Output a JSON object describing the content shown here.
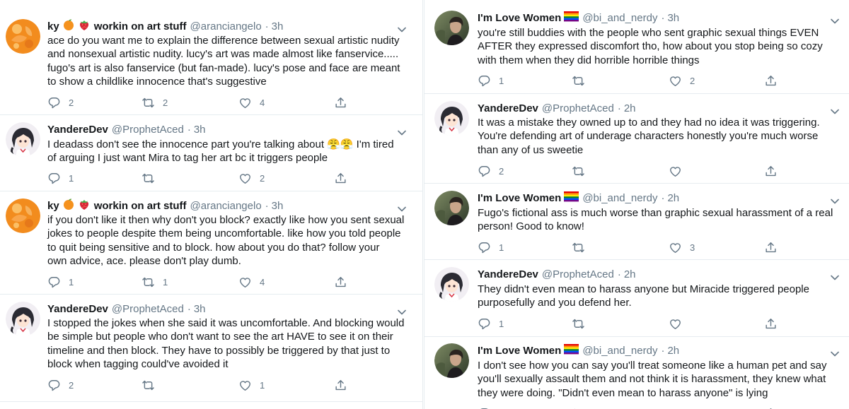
{
  "left_column": {
    "tweets": [
      {
        "name": "ky",
        "name_suffix": "workin on art stuff",
        "emoji_names": [
          "orange-emoji",
          "strawberry-emoji"
        ],
        "handle": "@aranciangelo",
        "time": "3h",
        "avatar": "orange-avatar",
        "lines": [
          "ace do you want me to explain the difference between sexual artistic nudity",
          "and nonsexual artistic nudity. lucy's art was made almost like fanservice.....",
          "fugo's art is also fanservice (but fan-made). lucy's pose and face are meant",
          "to show a childlike innocence that's suggestive"
        ],
        "replies": "2",
        "retweets": "2",
        "likes": "4"
      },
      {
        "name": "YandereDev",
        "handle": "@ProphetAced",
        "time": "3h",
        "avatar": "anime-avatar",
        "lines": [
          "I deadass don't see the innocence part you're talking about 😤😤 I'm tired",
          "of arguing I just want Mira to tag her art bc it triggers people"
        ],
        "replies": "1",
        "retweets": "",
        "likes": "2"
      },
      {
        "name": "ky",
        "name_suffix": "workin on art stuff",
        "emoji_names": [
          "orange-emoji",
          "strawberry-emoji"
        ],
        "handle": "@aranciangelo",
        "time": "3h",
        "avatar": "orange-avatar",
        "lines": [
          "if you don't like it then why don't you block? exactly like how you sent sexual",
          "jokes to people despite them being uncomfortable. like how you told people",
          "to quit being sensitive and to block. how about you do that? follow your",
          "own advice, ace. please don't play dumb."
        ],
        "replies": "1",
        "retweets": "1",
        "likes": "4"
      },
      {
        "name": "YandereDev",
        "handle": "@ProphetAced",
        "time": "3h",
        "avatar": "anime-avatar",
        "lines": [
          "I stopped the jokes when she said it was uncomfortable. And blocking would",
          "be simple but people who don't want to see the art HAVE to see it on their",
          "timeline and then block. They have to possibly be triggered by that just to",
          "block when tagging could've avoided it"
        ],
        "replies": "2",
        "retweets": "",
        "likes": "1"
      }
    ]
  },
  "right_column": {
    "tweets": [
      {
        "name": "I'm Love Women",
        "emoji_names": [
          "rainbow-flag-emoji"
        ],
        "handle": "@bi_and_nerdy",
        "time": "3h",
        "avatar": "photo-avatar",
        "lines": [
          "you're still buddies with the people who sent graphic sexual things EVEN",
          "AFTER they expressed discomfort tho, how about you stop being so cozy",
          "with them when they did horrible horrible things"
        ],
        "replies": "1",
        "retweets": "",
        "likes": "2"
      },
      {
        "name": "YandereDev",
        "handle": "@ProphetAced",
        "time": "2h",
        "avatar": "anime-avatar",
        "lines": [
          "It was a mistake they owned up to and they had no idea it was triggering.",
          "You're defending art of underage characters honestly you're much worse",
          "than any of us sweetie"
        ],
        "replies": "2",
        "retweets": "",
        "likes": ""
      },
      {
        "name": "I'm Love Women",
        "emoji_names": [
          "rainbow-flag-emoji"
        ],
        "handle": "@bi_and_nerdy",
        "time": "2h",
        "avatar": "photo-avatar",
        "lines": [
          "Fugo's fictional ass is much worse than graphic sexual harassment of a real",
          "person! Good to know!"
        ],
        "replies": "1",
        "retweets": "",
        "likes": "3"
      },
      {
        "name": "YandereDev",
        "handle": "@ProphetAced",
        "time": "2h",
        "avatar": "anime-avatar",
        "lines": [
          "They didn't even mean to harass anyone but Miracide triggered people",
          "purposefully and you defend her."
        ],
        "replies": "1",
        "retweets": "",
        "likes": ""
      },
      {
        "name": "I'm Love Women",
        "emoji_names": [
          "rainbow-flag-emoji"
        ],
        "handle": "@bi_and_nerdy",
        "time": "2h",
        "avatar": "photo-avatar",
        "lines": [
          "I don't see how you can say you'll treat someone like a human pet and say",
          "you'll sexually assault them and not think it is harassment, they knew what",
          "they were doing. \"Didn't even mean to harass anyone\" is lying"
        ],
        "replies": "",
        "retweets": "",
        "likes": ""
      }
    ]
  },
  "colors": {
    "text": "#14171a",
    "secondary": "#657786",
    "divider": "#e6ecf0",
    "orange_avatar": "#f28c1e"
  }
}
